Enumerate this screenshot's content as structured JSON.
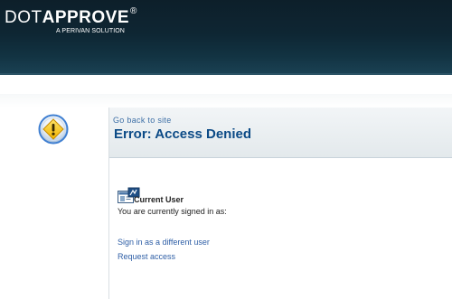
{
  "brand": {
    "name_part1": "DOT",
    "name_part2": "APPROVE",
    "registered": "®",
    "tagline": "A PERIVAN SOLUTION"
  },
  "icons": {
    "warning": "warning-icon",
    "user": "user-card-icon"
  },
  "colors": {
    "header_dark": "#0d1f2a",
    "title_blue": "#0b4a86",
    "link_blue": "#2f5fa6",
    "warning_yellow": "#f7c928",
    "warning_ring": "#3f7fd1"
  },
  "main": {
    "go_back": "Go back to site",
    "title": "Error: Access Denied",
    "current_user_heading": "Current User",
    "signed_in_text": "You are currently signed in as:",
    "links": {
      "sign_in_different": "Sign in as a different user",
      "request_access": "Request access"
    }
  }
}
